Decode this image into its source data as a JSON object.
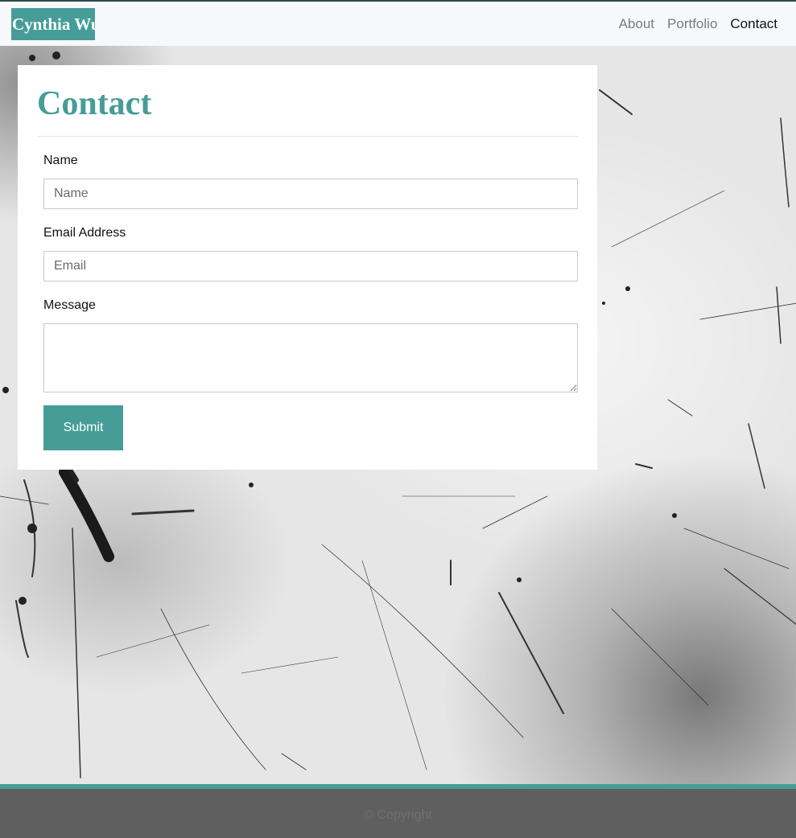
{
  "navbar": {
    "brand": "Cynthia Wu",
    "links": [
      {
        "label": "About",
        "active": false
      },
      {
        "label": "Portfolio",
        "active": false
      },
      {
        "label": "Contact",
        "active": true
      }
    ]
  },
  "contact": {
    "title": "Contact",
    "name_label": "Name",
    "name_placeholder": "Name",
    "email_label": "Email Address",
    "email_placeholder": "Email",
    "message_label": "Message",
    "submit_label": "Submit"
  },
  "footer": {
    "text": "© Copyright"
  },
  "colors": {
    "accent": "#469d97",
    "navbar_bg": "#f7f8f9",
    "footer_bg": "#5f5f5f"
  }
}
